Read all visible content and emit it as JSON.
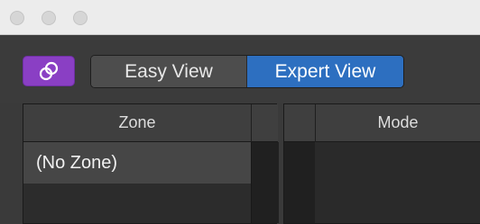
{
  "window": {
    "traffic_lights": [
      "close",
      "minimize",
      "zoom"
    ]
  },
  "toolbar": {
    "link_icon": "link-icon",
    "accent_color": "#8a3fc4",
    "views": [
      {
        "label": "Easy View",
        "selected": false
      },
      {
        "label": "Expert View",
        "selected": true
      }
    ],
    "selected_color": "#2d6fc0"
  },
  "zone_panel": {
    "header": "Zone",
    "rows": [
      "(No Zone)"
    ]
  },
  "mode_panel": {
    "header": "Mode"
  }
}
